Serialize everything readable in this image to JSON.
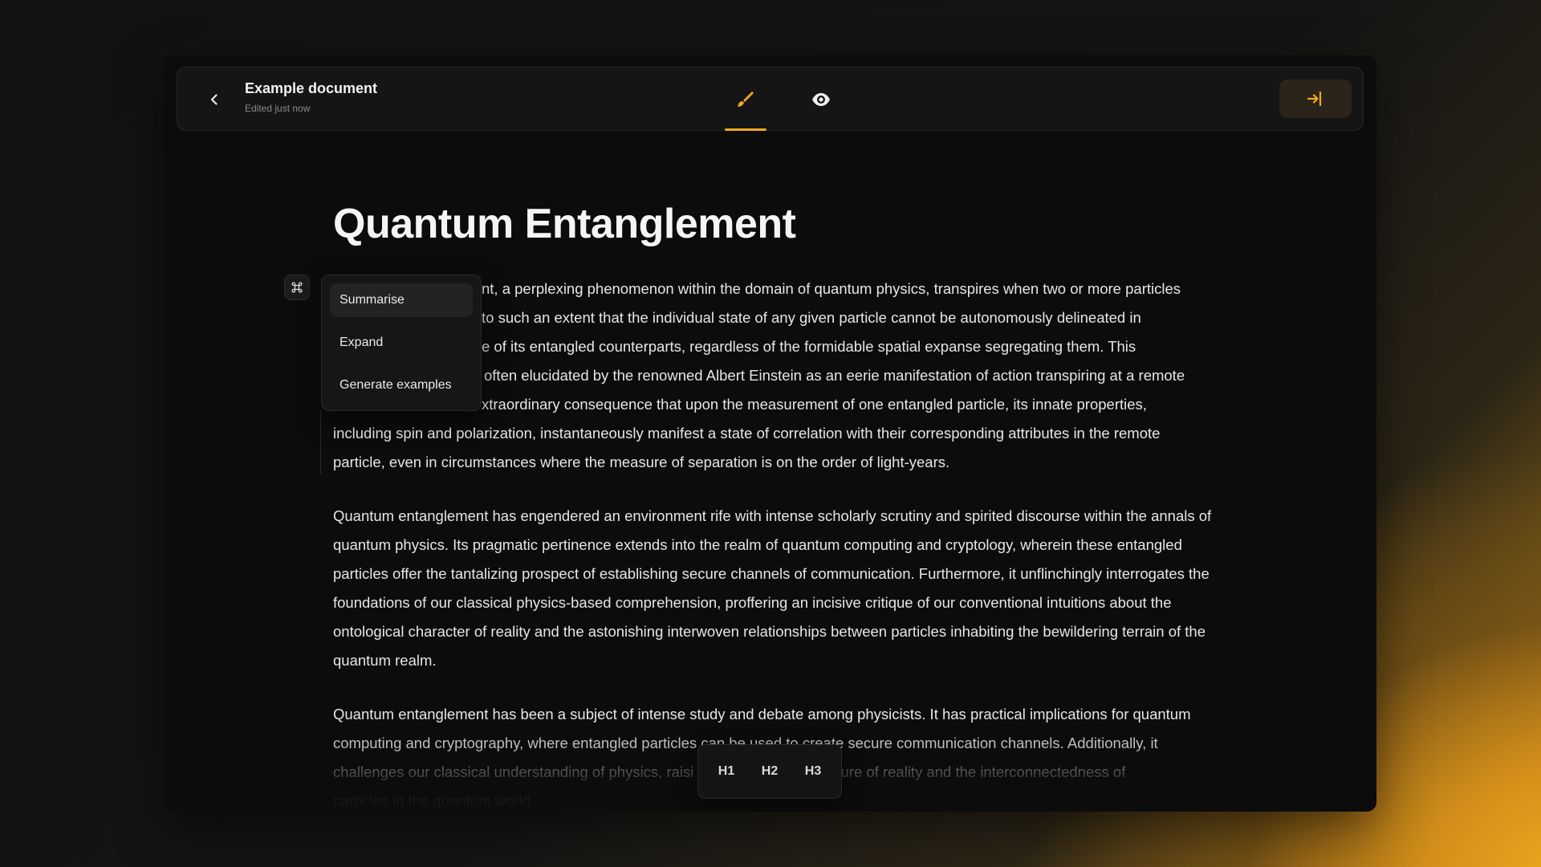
{
  "topbar": {
    "doc_title": "Example document",
    "doc_status": "Edited just now",
    "back_icon": "chevron-left-icon",
    "edit_icon": "brush-icon",
    "preview_icon": "eye-icon",
    "export_icon": "sign-in-arrow-icon",
    "accent_color": "#f0a820"
  },
  "document": {
    "title": "Quantum Entanglement",
    "paragraph1": {
      "lines": [
        "nt, a perplexing phenomenon within the domain of quantum physics, transpires when two or more particles",
        "to such an extent that the individual state of any given particle cannot be autonomously delineated in",
        "e of its entangled counterparts, regardless of the formidable spatial expanse segregating them. This",
        "often elucidated by the renowned Albert Einstein as an eerie manifestation of action transpiring at a remote",
        "xtraordinary consequence that upon the measurement of one entangled particle, its innate properties,",
        "including spin and polarization, instantaneously manifest a state of correlation with their corresponding attributes in the remote",
        "particle, even in circumstances where the measure of separation is on the order of light-years."
      ]
    },
    "paragraph2": "Quantum entanglement has engendered an environment rife with intense scholarly scrutiny and spirited discourse within the annals of quantum physics. Its pragmatic pertinence extends into the realm of quantum computing and cryptology, wherein these entangled particles offer the tantalizing prospect of establishing secure channels of communication. Furthermore, it unflinchingly interrogates the foundations of our classical physics-based comprehension, proffering an incisive critique of our conventional intuitions about the ontological character of reality and the astonishing interwoven relationships between particles inhabiting the bewildering terrain of the quantum realm.",
    "paragraph3": {
      "line1": "Quantum entanglement has been a subject of intense study and debate among physicists. It has practical implications for quantum",
      "line2": "computing and cryptography, where entangled particles can be used to create secure communication channels. Additionally, it",
      "line3": "challenges our classical understanding of physics, raisi",
      "line3_end": "e nature of reality and the interconnectedness of",
      "line4": "particles in the quantum world."
    }
  },
  "ai_menu": {
    "icon": "command-icon",
    "items": [
      "Summarise",
      "Expand",
      "Generate examples"
    ],
    "active_index": 0
  },
  "heading_bar": {
    "h1": "H1",
    "h2": "H2",
    "h3": "H3"
  }
}
